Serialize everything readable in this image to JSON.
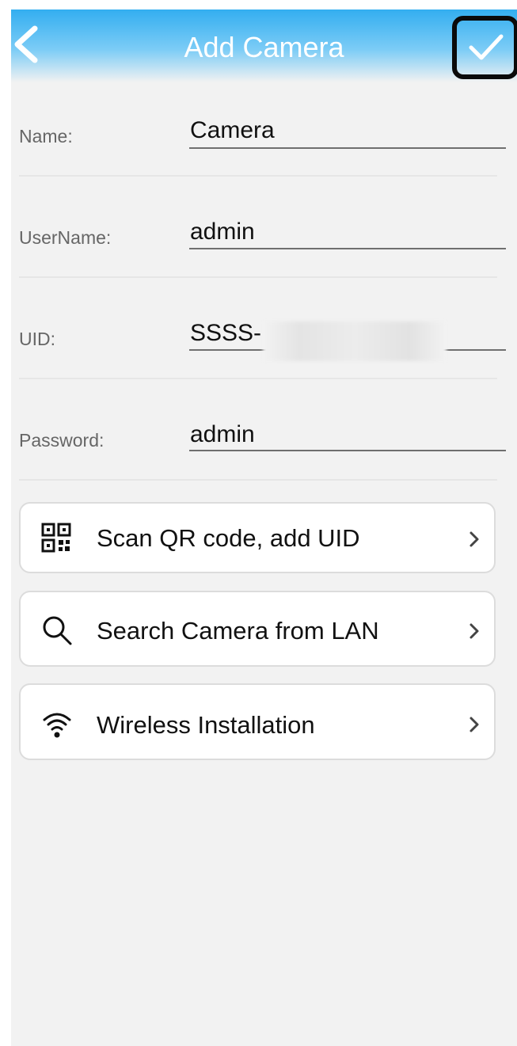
{
  "header": {
    "title": "Add Camera",
    "back_icon": "chevron-left-icon",
    "confirm_icon": "checkmark-icon"
  },
  "form": {
    "name": {
      "label": "Name:",
      "value": "Camera"
    },
    "username": {
      "label": "UserName:",
      "value": "admin"
    },
    "uid": {
      "label": "UID:",
      "value": "SSSS-"
    },
    "password": {
      "label": "Password:",
      "value": "admin"
    }
  },
  "actions": [
    {
      "label": "Scan QR code, add UID",
      "icon": "qr-code-icon"
    },
    {
      "label": "Search Camera from LAN",
      "icon": "search-icon"
    },
    {
      "label": "Wireless Installation",
      "icon": "wifi-icon"
    }
  ],
  "colors": {
    "header_top": "#33aef0",
    "background": "#f2f2f2",
    "text": "#111111",
    "label": "#666666"
  }
}
